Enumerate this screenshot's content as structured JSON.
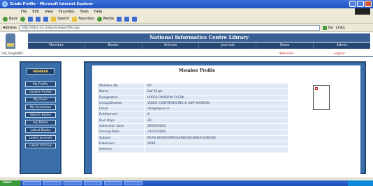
{
  "window": {
    "title": "Grade Profile - Microsoft Internet Explorer"
  },
  "menu": [
    "File",
    "Edit",
    "View",
    "Favorites",
    "Tools",
    "Help"
  ],
  "toolbar": {
    "back": "Back",
    "search": "Search",
    "favorites": "Favorites",
    "media": "Media"
  },
  "address": {
    "label": "Address",
    "value": "http://ddss.nic.in/gov/viewprofile.asp",
    "go": "Go",
    "links": "Links"
  },
  "site": {
    "title": "National Informatics Centre Library",
    "nav": [
      "Member",
      "Books",
      "Articles",
      "Journals",
      "News",
      "Admin"
    ]
  },
  "userbar": {
    "user": "Dal_Singh|NIC",
    "welcome": "Welcome",
    "logout": "Logout"
  },
  "sidebar": {
    "heading": "MEMBER",
    "items": [
      "My Profile",
      "Update Profile",
      "My Dues",
      "My Accession",
      "Search Books",
      "my Books",
      "Latest Books",
      "Latest Journals",
      "Latest Articles"
    ]
  },
  "profile": {
    "title": "Member Profile",
    "rows": [
      {
        "label": "Member_No",
        "value": "60"
      },
      {
        "label": "Name",
        "value": "Dal Singh"
      },
      {
        "label": "Designation",
        "value": "UPPER DIVISION CLERK"
      },
      {
        "label": "Group/Division",
        "value": "VIDEO CONFERENCING & ADP DIVISION"
      },
      {
        "label": "Email",
        "value": "dsingh@nic.in"
      },
      {
        "label": "Entitlement",
        "value": "4"
      },
      {
        "label": "Due Days",
        "value": "30"
      },
      {
        "label": "Admission Date",
        "value": "29/09/2004"
      },
      {
        "label": "Closing Date",
        "value": "31/03/2008"
      },
      {
        "label": "Subject",
        "value": "READ BOOKS/MAGAZINES/JOURNALS/NEWS"
      },
      {
        "label": "Extension",
        "value": "2090"
      },
      {
        "label": "Address",
        "value": ""
      }
    ]
  },
  "status": {
    "left": "Done",
    "right": "Local intranet"
  },
  "taskbar": {
    "start": "start"
  }
}
